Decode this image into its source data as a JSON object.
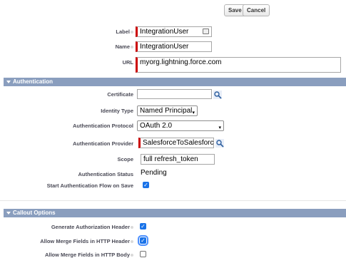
{
  "toolbar": {
    "save": "Save",
    "cancel": "Cancel"
  },
  "fields": {
    "label": {
      "label": "Label",
      "value": "IntegrationUser"
    },
    "name": {
      "label": "Name",
      "value": "IntegrationUser"
    },
    "url": {
      "label": "URL",
      "value": "myorg.lightning.force.com"
    }
  },
  "auth_section": {
    "title": "Authentication",
    "certificate": {
      "label": "Certificate",
      "value": ""
    },
    "identity_type": {
      "label": "Identity Type",
      "value": "Named Principal"
    },
    "auth_protocol": {
      "label": "Authentication Protocol",
      "value": "OAuth 2.0"
    },
    "auth_provider": {
      "label": "Authentication Provider",
      "value": "SalesforceToSalesforce"
    },
    "scope": {
      "label": "Scope",
      "value": "full refresh_token"
    },
    "auth_status": {
      "label": "Authentication Status",
      "value": "Pending"
    },
    "start_flow": {
      "label": "Start Authentication Flow on Save",
      "checked": true
    }
  },
  "callout_section": {
    "title": "Callout Options",
    "gen_auth_header": {
      "label": "Generate Authorization Header",
      "checked": true
    },
    "merge_header": {
      "label": "Allow Merge Fields in HTTP Header",
      "checked": true
    },
    "merge_body": {
      "label": "Allow Merge Fields in HTTP Body",
      "checked": false
    }
  }
}
